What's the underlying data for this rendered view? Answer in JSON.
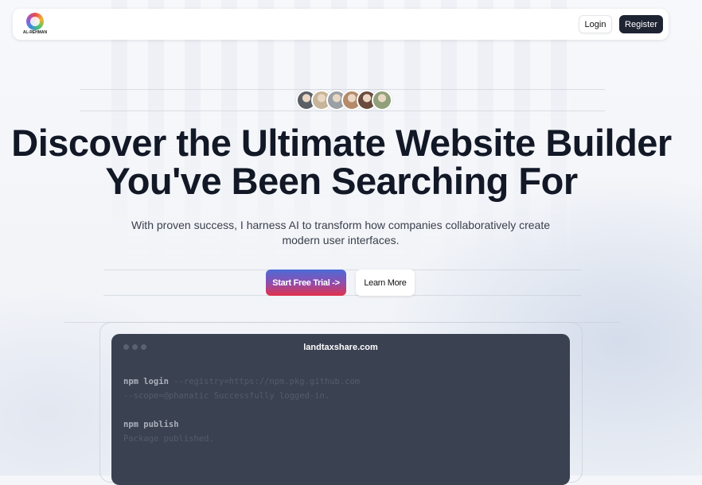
{
  "nav": {
    "logo_text": "AL-REHMAN",
    "login_label": "Login",
    "register_label": "Register"
  },
  "hero": {
    "avatar_colors": [
      "#5a5f66",
      "#c7b59a",
      "#9aa0a6",
      "#b48a6a",
      "#6a4b3e",
      "#8fa07a"
    ],
    "title_line1": "Discover the Ultimate Website Builder",
    "title_line2": "You've Been Searching For",
    "subtitle": "With proven success, I harness AI to transform how companies collaboratively create modern user interfaces.",
    "primary_cta": "Start Free Trial ->",
    "secondary_cta": "Learn More"
  },
  "terminal": {
    "title": "landtaxshare.com",
    "lines": [
      {
        "cmd": "npm login",
        "rest": " --registry=https://npm.pkg.github.com"
      },
      {
        "cmd": "",
        "rest": "--scope=@phanatic Successfully logged-in."
      },
      {
        "cmd": "",
        "rest": ""
      },
      {
        "cmd": "npm publish",
        "rest": ""
      },
      {
        "cmd": "",
        "rest": "Package published."
      }
    ]
  },
  "colors": {
    "primary_dark": "#1f2433",
    "title_text": "#121826",
    "terminal_bg": "#3a4150",
    "cta_gradient_top": "#4b6bd6",
    "cta_gradient_bottom": "#e3324b"
  }
}
